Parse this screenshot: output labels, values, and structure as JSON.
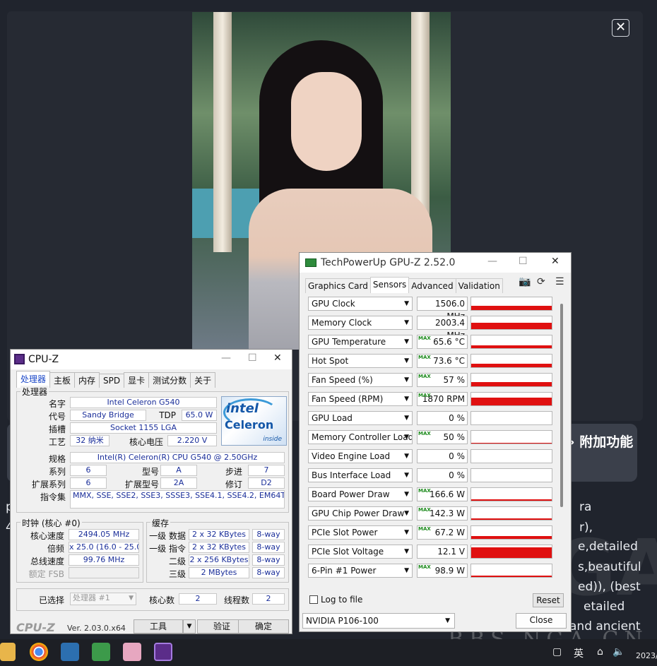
{
  "background": {
    "side_button_label": "附加功能",
    "text_fragments": [
      "ra",
      "r),",
      "e,detailed",
      "s,beautiful",
      "ed)), (best",
      "etailed",
      "and ancient"
    ],
    "left_fragments": [
      "p",
      "4",
      "1",
      "a",
      "c",
      "i",
      "l"
    ],
    "watermark": "BBS.NGA.CN",
    "close_glyph": "✕"
  },
  "cpuz": {
    "title": "CPU-Z",
    "tabs": [
      "处理器",
      "主板",
      "内存",
      "SPD",
      "显卡",
      "测试分数",
      "关于"
    ],
    "processor_group": "处理器",
    "name_label": "名字",
    "name_value": "Intel Celeron G540",
    "codename_label": "代号",
    "codename_value": "Sandy Bridge",
    "tdp_label": "TDP",
    "tdp_value": "65.0 W",
    "package_label": "插槽",
    "package_value": "Socket 1155 LGA",
    "tech_label": "工艺",
    "tech_value": "32 纳米",
    "voltage_label": "核心电压",
    "voltage_value": "2.220 V",
    "spec_label": "规格",
    "spec_value": "Intel(R) Celeron(R) CPU G540 @ 2.50GHz",
    "family_label": "系列",
    "family_value": "6",
    "model_label": "型号",
    "model_value": "A",
    "stepping_label": "步进",
    "stepping_value": "7",
    "extfamily_label": "扩展系列",
    "extfamily_value": "6",
    "extmodel_label": "扩展型号",
    "extmodel_value": "2A",
    "revision_label": "修订",
    "revision_value": "D2",
    "instr_label": "指令集",
    "instr_value": "MMX, SSE, SSE2, SSE3, SSSE3, SSE4.1, SSE4.2, EM64T, VT-x",
    "logo": {
      "brand": "intel",
      "product": "Celeron",
      "tag": "inside"
    },
    "clocks_group": "时钟 (核心 #0)",
    "core_speed_label": "核心速度",
    "core_speed_value": "2494.05 MHz",
    "multiplier_label": "倍频",
    "multiplier_value": "x 25.0 (16.0 - 25.0)",
    "bus_label": "总线速度",
    "bus_value": "99.76 MHz",
    "fsb_label": "额定 FSB",
    "fsb_value": "",
    "cache_group": "缓存",
    "l1d_label": "一级 数据",
    "l1d_value": "2 x 32 KBytes",
    "l1d_way": "8-way",
    "l1i_label": "一级 指令",
    "l1i_value": "2 x 32 KBytes",
    "l1i_way": "8-way",
    "l2_label": "二级",
    "l2_value": "2 x 256 KBytes",
    "l2_way": "8-way",
    "l3_label": "三级",
    "l3_value": "2 MBytes",
    "l3_way": "8-way",
    "selection_label": "已选择",
    "selection_value": "处理器 #1",
    "cores_label": "核心数",
    "cores_value": "2",
    "threads_label": "线程数",
    "threads_value": "2",
    "brand": "CPU-Z",
    "version": "Ver. 2.03.0.x64",
    "tools_label": "工具",
    "validate_label": "验证",
    "ok_label": "确定"
  },
  "gpuz": {
    "title": "TechPowerUp GPU-Z 2.52.0",
    "tabs": [
      "Graphics Card",
      "Sensors",
      "Advanced",
      "Validation"
    ],
    "sensors": [
      {
        "name": "GPU Clock",
        "value": "1506.0 MHz",
        "max": false,
        "level": 0.35
      },
      {
        "name": "Memory Clock",
        "value": "2003.4 MHz",
        "max": false,
        "level": 0.5
      },
      {
        "name": "GPU Temperature",
        "value": "65.6 °C",
        "max": true,
        "level": 0.2
      },
      {
        "name": "Hot Spot",
        "value": "73.6 °C",
        "max": true,
        "level": 0.3
      },
      {
        "name": "Fan Speed (%)",
        "value": "57 %",
        "max": true,
        "level": 0.35
      },
      {
        "name": "Fan Speed (RPM)",
        "value": "1870 RPM",
        "max": true,
        "level": 0.6
      },
      {
        "name": "GPU Load",
        "value": "0 %",
        "max": false,
        "level": 0
      },
      {
        "name": "Memory Controller Load",
        "value": "50 %",
        "max": true,
        "level": 0.05
      },
      {
        "name": "Video Engine Load",
        "value": "0 %",
        "max": false,
        "level": 0
      },
      {
        "name": "Bus Interface Load",
        "value": "0 %",
        "max": false,
        "level": 0
      },
      {
        "name": "Board Power Draw",
        "value": "166.6 W",
        "max": true,
        "level": 0.12
      },
      {
        "name": "GPU Chip Power Draw",
        "value": "142.3 W",
        "max": true,
        "level": 0.12
      },
      {
        "name": "PCIe Slot Power",
        "value": "67.2 W",
        "max": true,
        "level": 0.2
      },
      {
        "name": "PCIe Slot Voltage",
        "value": "12.1 V",
        "max": false,
        "level": 0.85
      },
      {
        "name": "6-Pin #1 Power",
        "value": "98.9 W",
        "max": true,
        "level": 0.1
      }
    ],
    "max_tag": "MAX",
    "log_label": "Log to file",
    "reset_label": "Reset",
    "gpu_selected": "NVIDIA P106-100",
    "close_label": "Close"
  },
  "taskbar": {
    "ime": "英",
    "date_fragment": "2023/"
  }
}
